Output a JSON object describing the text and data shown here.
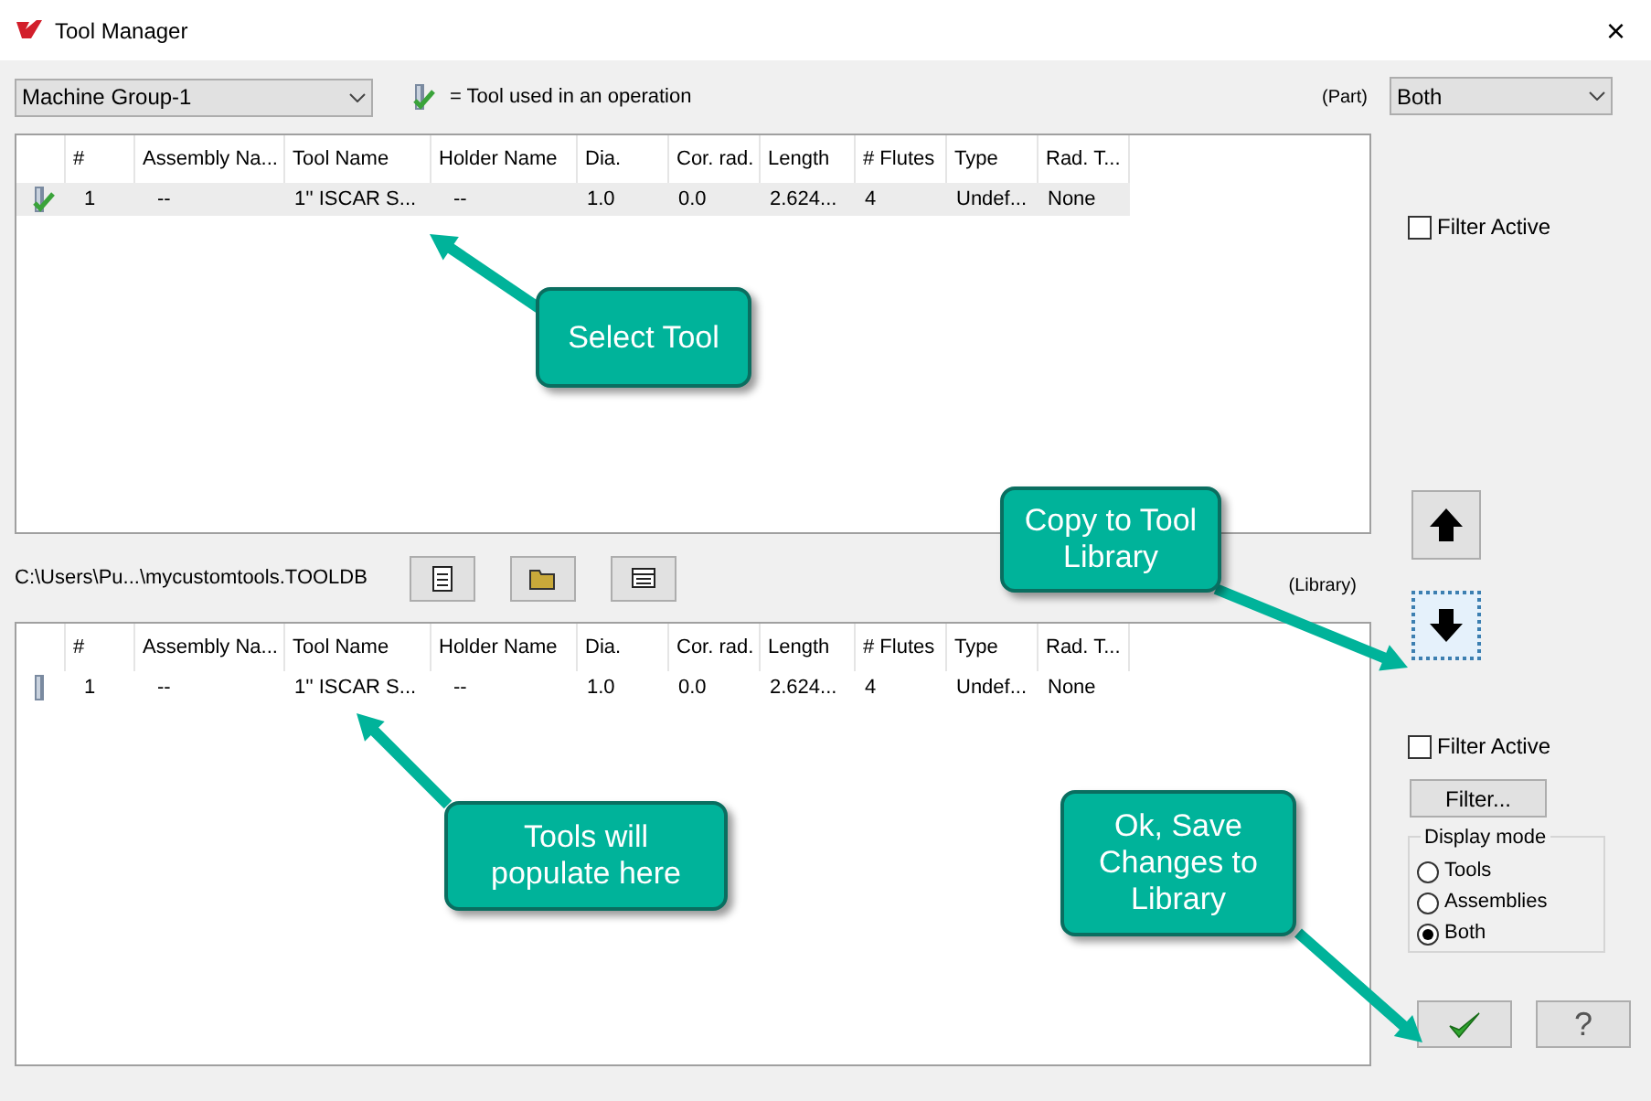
{
  "window": {
    "title": "Tool Manager",
    "close": "×"
  },
  "machine_group": {
    "value": "Machine Group-1"
  },
  "legend": "= Tool used in an operation",
  "part_label": "(Part)",
  "part_filter": {
    "value": "Both"
  },
  "part_table": {
    "columns": [
      "#",
      "Assembly Na...",
      "Tool Name",
      "Holder Name",
      "Dia.",
      "Cor. rad.",
      "Length",
      "# Flutes",
      "Type",
      "Rad. T..."
    ],
    "rows": [
      {
        "used": true,
        "selected": true,
        "cells": [
          "1",
          "--",
          "1'' ISCAR S...",
          "--",
          "1.0",
          "0.0",
          "2.624...",
          "4",
          "Undef...",
          "None"
        ]
      }
    ]
  },
  "part_filter_active": {
    "label": "Filter Active",
    "checked": false
  },
  "library_path": "C:\\Users\\Pu...\\mycustomtools.TOOLDB",
  "library_label": "(Library)",
  "library_table": {
    "columns": [
      "#",
      "Assembly Na...",
      "Tool Name",
      "Holder Name",
      "Dia.",
      "Cor. rad.",
      "Length",
      "# Flutes",
      "Type",
      "Rad. T..."
    ],
    "rows": [
      {
        "used": false,
        "selected": false,
        "cells": [
          "1",
          "--",
          "1'' ISCAR S...",
          "--",
          "1.0",
          "0.0",
          "2.624...",
          "4",
          "Undef...",
          "None"
        ]
      }
    ]
  },
  "library_filter_active": {
    "label": "Filter Active",
    "checked": false
  },
  "filter_button": "Filter...",
  "display_mode": {
    "title": "Display mode",
    "options": [
      {
        "label": "Tools",
        "selected": false
      },
      {
        "label": "Assemblies",
        "selected": false
      },
      {
        "label": "Both",
        "selected": true
      }
    ]
  },
  "help_button": "?",
  "callouts": [
    "Select Tool",
    "Copy to Tool Library",
    "Tools will populate here",
    "Ok, Save Changes to Library"
  ]
}
